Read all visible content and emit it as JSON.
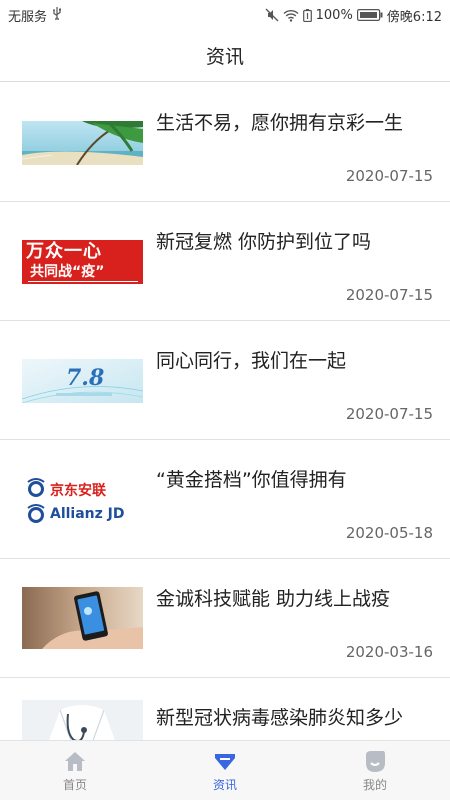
{
  "status_bar": {
    "carrier": "无服务",
    "battery": "100%",
    "time": "傍晚6:12"
  },
  "header": {
    "title": "资讯"
  },
  "news": [
    {
      "title": "生活不易，愿你拥有京彩一生",
      "date": "2020-07-15",
      "thumb": "palm-beach-image"
    },
    {
      "title": "新冠复燃 你防护到位了吗",
      "date": "2020-07-15",
      "thumb": "banner-image",
      "thumb_text_top": "万众一心",
      "thumb_text_bottom": "共同战“疫”"
    },
    {
      "title": "同心同行，我们在一起",
      "date": "2020-07-15",
      "thumb": "anniversary-image",
      "thumb_text": "7.8"
    },
    {
      "title": "“黄金搭档”你值得拥有",
      "date": "2020-05-18",
      "thumb": "logo-image",
      "thumb_text_top": "京东安联",
      "thumb_text_bottom": "Allianz JD"
    },
    {
      "title": "金诚科技赋能  助力线上战疫",
      "date": "2020-03-16",
      "thumb": "phone-hand-image"
    },
    {
      "title": "新型冠状病毒感染肺炎知多少",
      "date": "",
      "thumb": "doctor-image"
    }
  ],
  "tabs": [
    {
      "label": "首页",
      "icon": "home-icon"
    },
    {
      "label": "资讯",
      "icon": "news-icon",
      "active": true
    },
    {
      "label": "我的",
      "icon": "profile-icon"
    }
  ],
  "colors": {
    "accent": "#3a66e0",
    "banner_red": "#d8211c"
  }
}
